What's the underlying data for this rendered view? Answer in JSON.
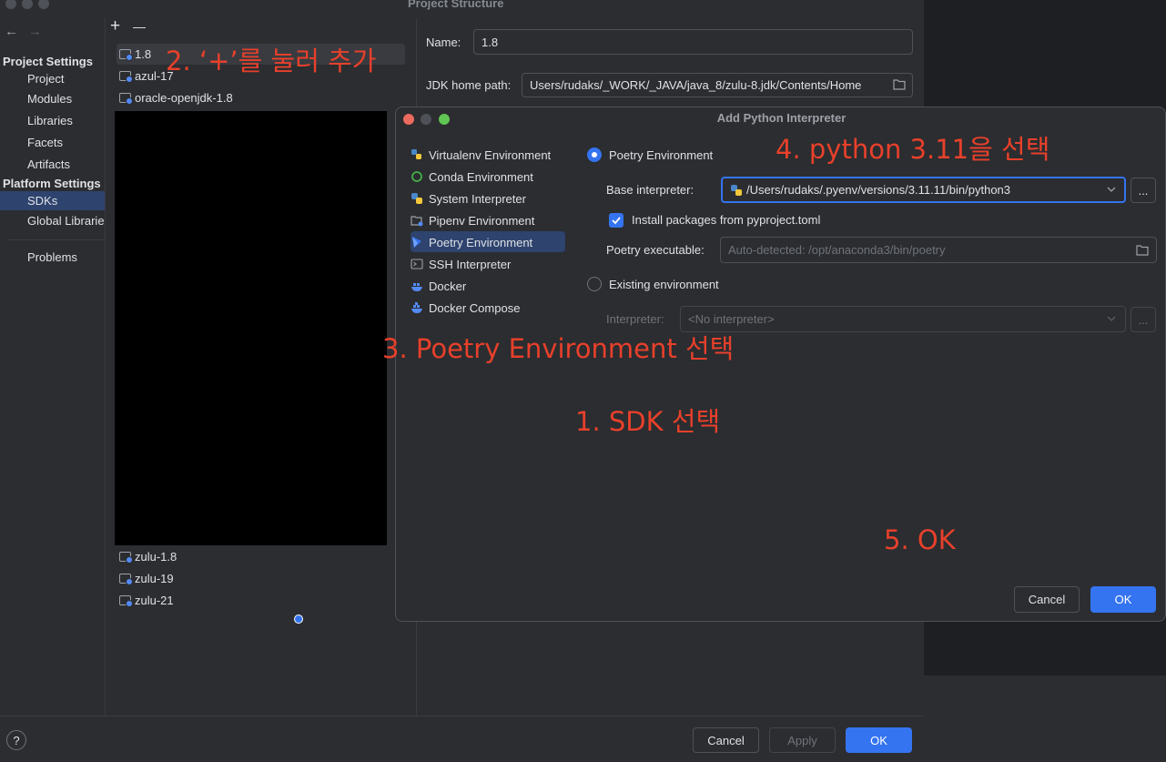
{
  "window": {
    "title": "Project Structure",
    "nav_back": "←",
    "nav_forward": "→",
    "add": "+",
    "remove": "—"
  },
  "left_nav": {
    "project_settings": "Project Settings",
    "project_items": [
      "Project",
      "Modules",
      "Libraries",
      "Facets",
      "Artifacts"
    ],
    "platform_settings": "Platform Settings",
    "platform_items": [
      "SDKs",
      "Global Libraries"
    ],
    "problems": "Problems"
  },
  "sdk_list": {
    "top": [
      "1.8",
      "azul-17",
      "oracle-openjdk-1.8"
    ],
    "bottom": [
      "zulu-1.8",
      "zulu-19",
      "zulu-21"
    ]
  },
  "details": {
    "name_label": "Name:",
    "name_value": "1.8",
    "jdk_home_label": "JDK home path:",
    "jdk_home_value": "Users/rudaks/_WORK/_JAVA/java_8/zulu-8.jdk/Contents/Home"
  },
  "footer": {
    "help": "?",
    "cancel": "Cancel",
    "apply": "Apply",
    "ok": "OK"
  },
  "dialog": {
    "title": "Add Python Interpreter",
    "environments": [
      {
        "label": "Virtualenv Environment",
        "icon": "python-venv-icon"
      },
      {
        "label": "Conda Environment",
        "icon": "conda-icon"
      },
      {
        "label": "System Interpreter",
        "icon": "python-icon"
      },
      {
        "label": "Pipenv Environment",
        "icon": "pipenv-icon"
      },
      {
        "label": "Poetry Environment",
        "icon": "poetry-icon"
      },
      {
        "label": "SSH Interpreter",
        "icon": "terminal-icon"
      },
      {
        "label": "Docker",
        "icon": "docker-icon"
      },
      {
        "label": "Docker Compose",
        "icon": "docker-compose-icon"
      }
    ],
    "selected_environment": "Poetry Environment",
    "poetry_radio": "Poetry Environment",
    "base_interpreter_label": "Base interpreter:",
    "base_interpreter_value": "/Users/rudaks/.pyenv/versions/3.11.11/bin/python3",
    "browse": "...",
    "install_packages_label": "Install packages from pyproject.toml",
    "install_packages_checked": true,
    "poetry_executable_label": "Poetry executable:",
    "poetry_executable_placeholder": "Auto-detected: /opt/anaconda3/bin/poetry",
    "existing_radio": "Existing environment",
    "interpreter_label": "Interpreter:",
    "interpreter_value": "<No interpreter>",
    "cancel": "Cancel",
    "ok": "OK"
  },
  "annotations": {
    "step2": "2. ‘+’를 눌러 추가",
    "step4": "4. python 3.11을 선택",
    "step3": "3. Poetry Environment 선택",
    "step1": "1. SDK 선택",
    "step5": "5. OK"
  },
  "colors": {
    "accent": "#3574f0",
    "selection": "#2e436e",
    "annotation": "#e8402b"
  }
}
